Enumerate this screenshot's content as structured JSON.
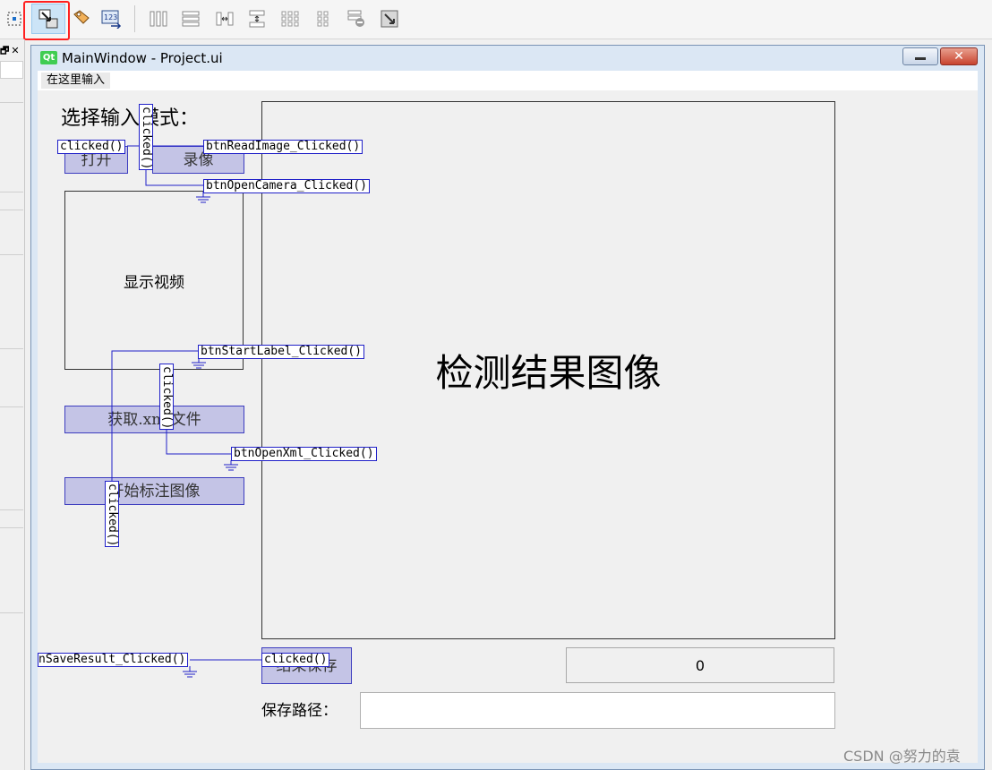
{
  "window": {
    "title": "MainWindow - Project.ui",
    "logo_text": "Qt",
    "close_glyph": "✕"
  },
  "menubar": {
    "type_here": "在这里输入"
  },
  "toolbar": {
    "icons": [
      "widget-edit-icon",
      "signal-slot-edit-icon",
      "buddy-edit-icon",
      "tab-order-edit-icon",
      "layout-horizontal-icon",
      "layout-vertical-icon",
      "splitter-horizontal-icon",
      "splitter-vertical-icon",
      "layout-grid-icon",
      "layout-form-icon",
      "break-layout-icon",
      "adjust-size-icon"
    ],
    "active_icon": "signal-slot-edit-icon",
    "highlight_color": "#ff2020"
  },
  "dock": {
    "icons": "🗗✕"
  },
  "form": {
    "mode_label": "选择输入模式：",
    "open_button": "打开",
    "record_button": "录像",
    "video_label": "显示视频",
    "get_xml_button": "获取.xml文件",
    "start_label_button": "开始标注图像",
    "result_label": "检测结果图像",
    "save_button": "结果保存",
    "lcd_value": "0",
    "path_label": "保存路径：",
    "path_value": ""
  },
  "connections": [
    {
      "signal": "clicked()",
      "slot": "btnReadImage_Clicked()"
    },
    {
      "signal": "clicked()",
      "slot": "btnOpenCamera_Clicked()"
    },
    {
      "signal": "clicked()",
      "slot": "btnOpenXml_Clicked()"
    },
    {
      "signal": "clicked()",
      "slot": "btnStartLabel_Clicked()"
    },
    {
      "signal": "clicked()",
      "slot": "nSaveResult_Clicked()"
    }
  ],
  "colors": {
    "widget_fill": "#c4c4e6",
    "connection_line": "#2020c8",
    "title_bar": "#dbe7f4"
  },
  "watermark": "CSDN @努力的袁"
}
